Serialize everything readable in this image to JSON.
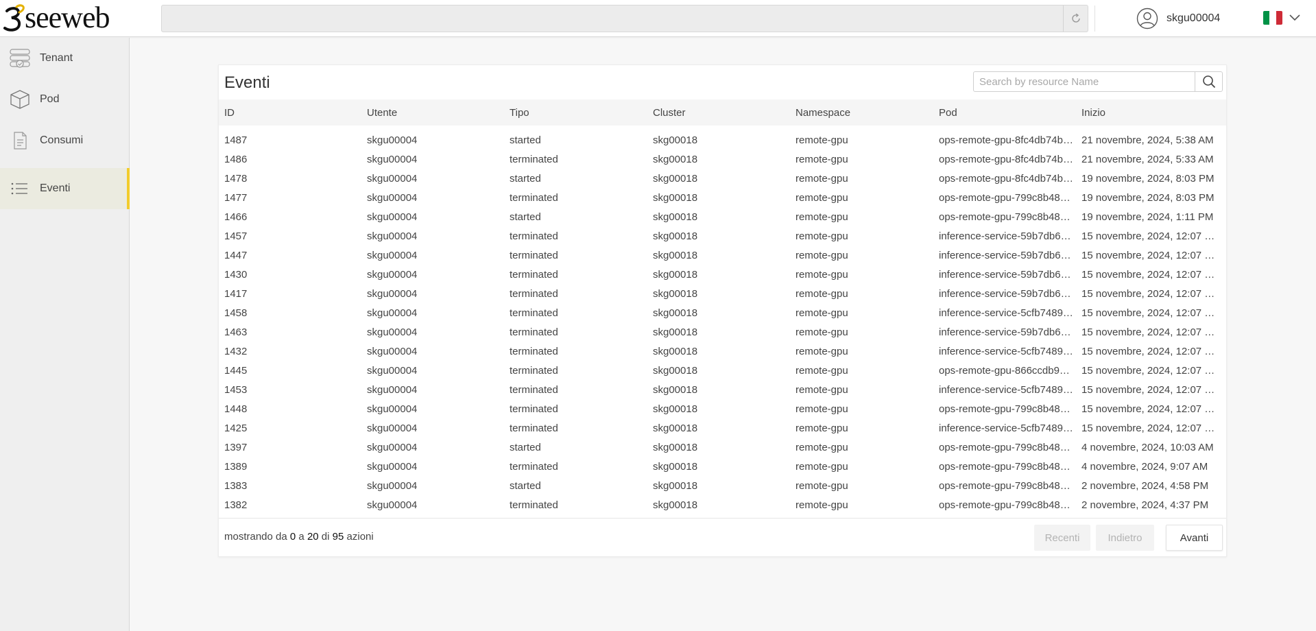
{
  "header": {
    "logo_text": "seeweb",
    "context_value": "",
    "username": "skgu00004",
    "language": "it"
  },
  "colors": {
    "accent": "#f2cc2c",
    "flag_green": "#009246",
    "flag_white": "#ffffff",
    "flag_red": "#ce2b37"
  },
  "sidebar": {
    "items": [
      {
        "label": "Tenant",
        "icon": "tenant-icon"
      },
      {
        "label": "Pod",
        "icon": "cube-icon"
      },
      {
        "label": "Consumi",
        "icon": "document-icon"
      },
      {
        "label": "Eventi",
        "icon": "list-icon",
        "active": true
      }
    ]
  },
  "main": {
    "title": "Eventi",
    "search_placeholder": "Search by resource Name",
    "columns": [
      "ID",
      "Utente",
      "Tipo",
      "Cluster",
      "Namespace",
      "Pod",
      "Inizio"
    ],
    "rows": [
      [
        "1487",
        "skgu00004",
        "started",
        "skg00018",
        "remote-gpu",
        "ops-remote-gpu-8fc4db74b…",
        "21 novembre, 2024, 5:38 AM"
      ],
      [
        "1486",
        "skgu00004",
        "terminated",
        "skg00018",
        "remote-gpu",
        "ops-remote-gpu-8fc4db74b…",
        "21 novembre, 2024, 5:33 AM"
      ],
      [
        "1478",
        "skgu00004",
        "started",
        "skg00018",
        "remote-gpu",
        "ops-remote-gpu-8fc4db74b…",
        "19 novembre, 2024, 8:03 PM"
      ],
      [
        "1477",
        "skgu00004",
        "terminated",
        "skg00018",
        "remote-gpu",
        "ops-remote-gpu-799c8b48…",
        "19 novembre, 2024, 8:03 PM"
      ],
      [
        "1466",
        "skgu00004",
        "started",
        "skg00018",
        "remote-gpu",
        "ops-remote-gpu-799c8b48…",
        "19 novembre, 2024, 1:11 PM"
      ],
      [
        "1457",
        "skgu00004",
        "terminated",
        "skg00018",
        "remote-gpu",
        "inference-service-59b7db6…",
        "15 novembre, 2024, 12:07 P…"
      ],
      [
        "1447",
        "skgu00004",
        "terminated",
        "skg00018",
        "remote-gpu",
        "inference-service-59b7db6…",
        "15 novembre, 2024, 12:07 P…"
      ],
      [
        "1430",
        "skgu00004",
        "terminated",
        "skg00018",
        "remote-gpu",
        "inference-service-59b7db6…",
        "15 novembre, 2024, 12:07 P…"
      ],
      [
        "1417",
        "skgu00004",
        "terminated",
        "skg00018",
        "remote-gpu",
        "inference-service-59b7db6…",
        "15 novembre, 2024, 12:07 P…"
      ],
      [
        "1458",
        "skgu00004",
        "terminated",
        "skg00018",
        "remote-gpu",
        "inference-service-5cfb7489…",
        "15 novembre, 2024, 12:07 P…"
      ],
      [
        "1463",
        "skgu00004",
        "terminated",
        "skg00018",
        "remote-gpu",
        "inference-service-59b7db6…",
        "15 novembre, 2024, 12:07 P…"
      ],
      [
        "1432",
        "skgu00004",
        "terminated",
        "skg00018",
        "remote-gpu",
        "inference-service-5cfb7489…",
        "15 novembre, 2024, 12:07 P…"
      ],
      [
        "1445",
        "skgu00004",
        "terminated",
        "skg00018",
        "remote-gpu",
        "ops-remote-gpu-866ccdb9…",
        "15 novembre, 2024, 12:07 P…"
      ],
      [
        "1453",
        "skgu00004",
        "terminated",
        "skg00018",
        "remote-gpu",
        "inference-service-5cfb7489…",
        "15 novembre, 2024, 12:07 P…"
      ],
      [
        "1448",
        "skgu00004",
        "terminated",
        "skg00018",
        "remote-gpu",
        "ops-remote-gpu-799c8b48…",
        "15 novembre, 2024, 12:07 P…"
      ],
      [
        "1425",
        "skgu00004",
        "terminated",
        "skg00018",
        "remote-gpu",
        "inference-service-5cfb7489…",
        "15 novembre, 2024, 12:07 P…"
      ],
      [
        "1397",
        "skgu00004",
        "started",
        "skg00018",
        "remote-gpu",
        "ops-remote-gpu-799c8b48…",
        "4 novembre, 2024, 10:03 AM"
      ],
      [
        "1389",
        "skgu00004",
        "terminated",
        "skg00018",
        "remote-gpu",
        "ops-remote-gpu-799c8b48…",
        "4 novembre, 2024, 9:07 AM"
      ],
      [
        "1383",
        "skgu00004",
        "started",
        "skg00018",
        "remote-gpu",
        "ops-remote-gpu-799c8b48…",
        "2 novembre, 2024, 4:58 PM"
      ],
      [
        "1382",
        "skgu00004",
        "terminated",
        "skg00018",
        "remote-gpu",
        "ops-remote-gpu-799c8b48…",
        "2 novembre, 2024, 4:37 PM"
      ]
    ],
    "footer": {
      "prefix": "mostrando da",
      "from": "0",
      "sep_a": "a",
      "to": "20",
      "sep_di": "di",
      "total": "95",
      "suffix": "azioni"
    },
    "pagination": {
      "recent_label": "Recenti",
      "back_label": "Indietro",
      "next_label": "Avanti"
    }
  }
}
